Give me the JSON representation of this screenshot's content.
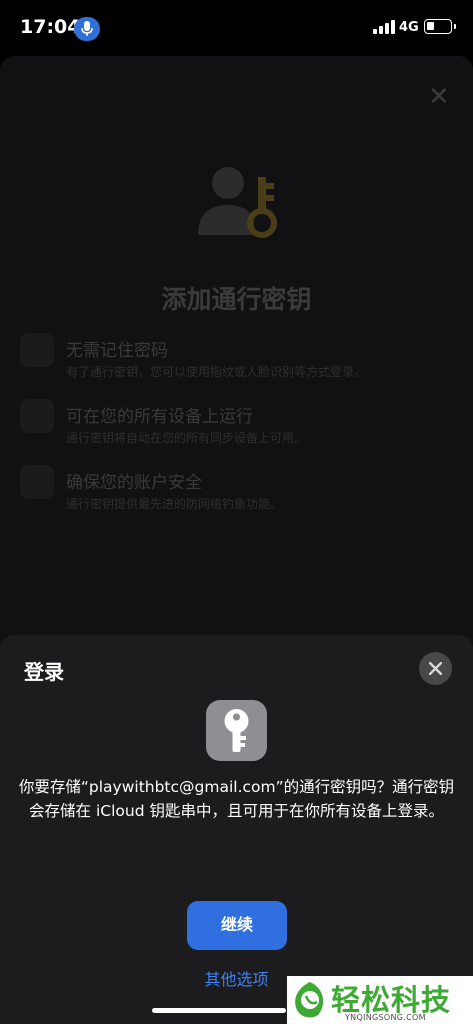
{
  "status_bar": {
    "time": "17:04",
    "network": "4G"
  },
  "background": {
    "title": "添加通行密钥",
    "features": [
      {
        "title": "无需记住密码",
        "desc": "有了通行密钥，您可以使用指纹或人脸识别等方式登录。",
        "icon": "fingerprint-icon"
      },
      {
        "title": "可在您的所有设备上运行",
        "desc": "通行密钥将自动在您的所有同步设备上可用。",
        "icon": "devices-icon"
      },
      {
        "title": "确保您的账户安全",
        "desc": "通行密钥提供最先进的防网络钓鱼功能。",
        "icon": "shield-icon"
      }
    ]
  },
  "sheet": {
    "title": "登录",
    "message": "你要存储“playwithbtc@gmail.com”的通行密钥吗？通行密钥会存储在 iCloud 钥匙串中，且可用于在你所有设备上登录。",
    "continue_label": "继续",
    "other_options_label": "其他选项"
  },
  "watermark": {
    "text": "轻松科技",
    "url": "YNQINGSONG.COM",
    "brand_color": "#3fa935"
  },
  "colors": {
    "accent": "#2f6fe0",
    "link": "#3a82f7",
    "sheet_bg": "#1c1c1e"
  }
}
